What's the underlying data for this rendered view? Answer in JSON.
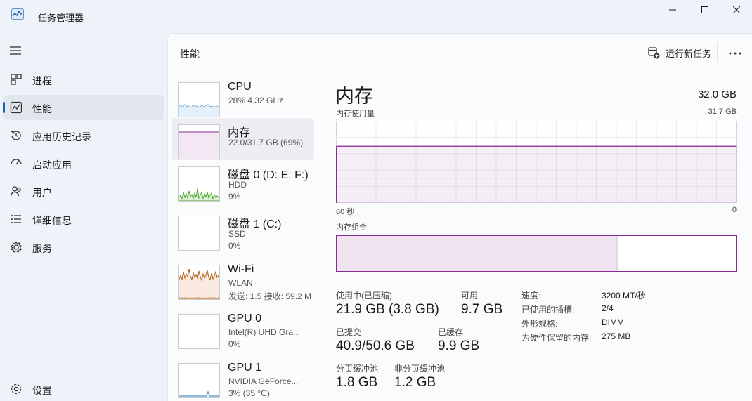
{
  "window": {
    "title": "任务管理器",
    "controls": {
      "minimize": "minimize-icon",
      "maximize": "maximize-icon",
      "close": "close-icon"
    }
  },
  "sidebar": {
    "items": [
      {
        "label": "进程",
        "icon": "processes-icon"
      },
      {
        "label": "性能",
        "icon": "performance-icon",
        "active": true
      },
      {
        "label": "应用历史记录",
        "icon": "app-history-icon"
      },
      {
        "label": "启动应用",
        "icon": "startup-icon"
      },
      {
        "label": "用户",
        "icon": "users-icon"
      },
      {
        "label": "详细信息",
        "icon": "details-icon"
      },
      {
        "label": "服务",
        "icon": "services-icon"
      }
    ],
    "settings": {
      "label": "设置",
      "icon": "settings-icon"
    }
  },
  "header": {
    "title": "性能",
    "run_new_task": "运行新任务",
    "more": "more-icon"
  },
  "devices": [
    {
      "name": "CPU",
      "line1": "28% 4.32 GHz",
      "line2": "",
      "color": "#1a78c2"
    },
    {
      "name": "内存",
      "line1": "22.0/31.7 GB (69%)",
      "line2": "",
      "color": "#8a2c93",
      "selected": true
    },
    {
      "name": "磁盘 0 (D: E: F:)",
      "line1": "HDD",
      "line2": "9%",
      "color": "#4ca62e"
    },
    {
      "name": "磁盘 1 (C:)",
      "line1": "SSD",
      "line2": "0%",
      "color": "#4ca62e"
    },
    {
      "name": "Wi-Fi",
      "line1": "WLAN",
      "line2": "发送: 1.5 接收: 59.2 M",
      "color": "#b05a10"
    },
    {
      "name": "GPU 0",
      "line1": "Intel(R) UHD Gra...",
      "line2": "0%",
      "color": "#1a78c2"
    },
    {
      "name": "GPU 1",
      "line1": "NVIDIA GeForce...",
      "line2": "3% (35 °C)",
      "color": "#1a78c2"
    }
  ],
  "memory": {
    "title": "内存",
    "total": "32.0 GB",
    "usage_caption": "内存使用量",
    "usage_max": "31.7 GB",
    "usage_fraction": 0.69,
    "time_left": "60 秒",
    "time_right": "0",
    "composition_caption": "内存组合",
    "composition_in_use_fraction": 0.69,
    "accent": "#8a2c93",
    "stats": {
      "in_use_label": "使用中(已压缩)",
      "in_use_value": "21.9 GB (3.8 GB)",
      "available_label": "可用",
      "available_value": "9.7 GB",
      "committed_label": "已提交",
      "committed_value": "40.9/50.6 GB",
      "cached_label": "已缓存",
      "cached_value": "9.9 GB",
      "paged_label": "分页缓冲池",
      "paged_value": "1.8 GB",
      "nonpaged_label": "非分页缓冲池",
      "nonpaged_value": "1.2 GB"
    },
    "properties": [
      {
        "key": "速度:",
        "value": "3200 MT/秒"
      },
      {
        "key": "已使用的插槽:",
        "value": "2/4"
      },
      {
        "key": "外形规格:",
        "value": "DIMM"
      },
      {
        "key": "为硬件保留的内存:",
        "value": "275 MB"
      }
    ]
  }
}
